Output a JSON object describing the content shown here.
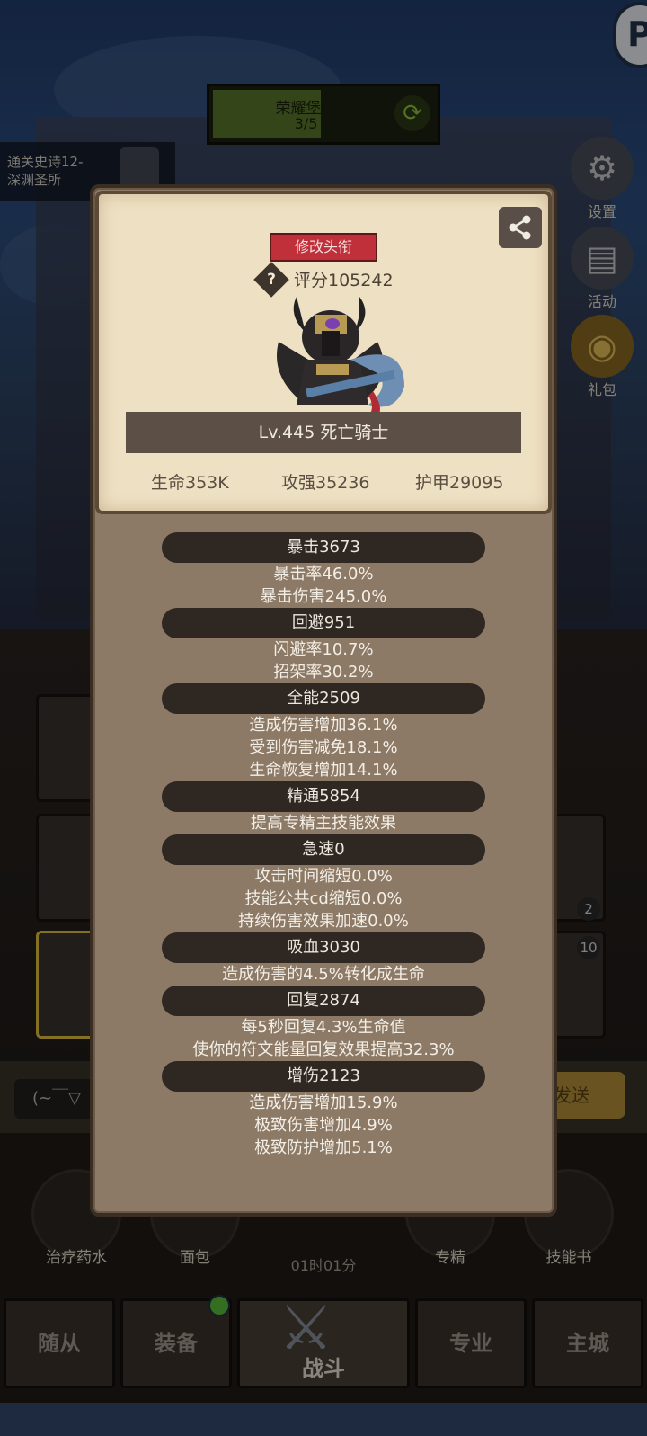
{
  "background": {
    "quest": {
      "title": "荣耀堡垒",
      "progress": "3/5",
      "progress_fraction": 0.6
    },
    "chapter": {
      "line1": "通关史诗12-",
      "line2": "深渊圣所"
    },
    "side_buttons": [
      {
        "label": "设置",
        "icon": "gear-icon"
      },
      {
        "label": "活动",
        "icon": "scroll-icon"
      },
      {
        "label": "礼包",
        "icon": "gift-icon"
      }
    ],
    "top_right_icon_letter": "P",
    "badges": {
      "right_card_1": "2",
      "right_card_2": "10"
    },
    "chat": {
      "input_text": "(~￣▽",
      "send_label": "发送"
    },
    "items": [
      {
        "label": "治疗药水"
      },
      {
        "label": "面包"
      },
      {
        "label": "专精"
      },
      {
        "label": "技能书"
      }
    ],
    "timer": "01时01分",
    "nav": [
      {
        "label": "随从"
      },
      {
        "label": "装备"
      },
      {
        "label": "战斗"
      },
      {
        "label": "专业"
      },
      {
        "label": "主城"
      }
    ]
  },
  "panel": {
    "title_button": "修改头衔",
    "score_label": "评分105242",
    "character_name": "Lv.445 死亡骑士",
    "stats": {
      "hp": "生命353K",
      "attack": "攻强35236",
      "armor": "护甲29095"
    },
    "groups": [
      {
        "head": "暴击3673",
        "lines": [
          "暴击率46.0%",
          "暴击伤害245.0%"
        ]
      },
      {
        "head": "回避951",
        "lines": [
          "闪避率10.7%",
          "招架率30.2%"
        ]
      },
      {
        "head": "全能2509",
        "lines": [
          "造成伤害增加36.1%",
          "受到伤害减免18.1%",
          "生命恢复增加14.1%"
        ]
      },
      {
        "head": "精通5854",
        "lines": [
          "提高专精主技能效果"
        ]
      },
      {
        "head": "急速0",
        "lines": [
          "攻击时间缩短0.0%",
          "技能公共cd缩短0.0%",
          "持续伤害效果加速0.0%"
        ]
      },
      {
        "head": "吸血3030",
        "lines": [
          "造成伤害的4.5%转化成生命"
        ]
      },
      {
        "head": "回复2874",
        "lines": [
          "每5秒回复4.3%生命值",
          "使你的符文能量回复效果提高32.3%"
        ]
      },
      {
        "head": "增伤2123",
        "lines": [
          "造成伤害增加15.9%",
          "极致伤害增加4.9%",
          "极致防护增加5.1%"
        ]
      }
    ]
  }
}
